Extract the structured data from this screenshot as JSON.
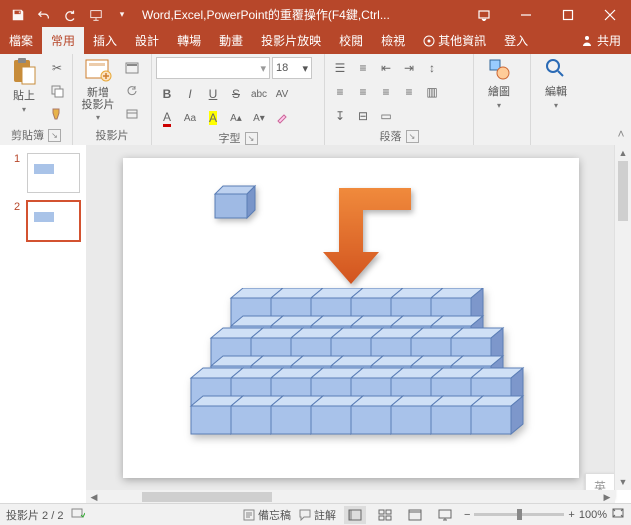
{
  "title": "Word,Excel,PowerPoint的重覆操作(F4鍵,Ctrl...",
  "tabs": {
    "file": "檔案",
    "home": "常用",
    "insert": "插入",
    "design": "設計",
    "transitions": "轉場",
    "animations": "動畫",
    "slideshow": "投影片放映",
    "review": "校閱",
    "view": "檢視",
    "tellme": "其他資訊",
    "signin": "登入",
    "share": "共用"
  },
  "ribbon": {
    "clipboard": {
      "label": "剪貼簿",
      "paste": "貼上"
    },
    "slides": {
      "label": "投影片",
      "new": "新增\n投影片"
    },
    "font": {
      "label": "字型",
      "size": "18"
    },
    "paragraph": {
      "label": "段落"
    },
    "drawing": {
      "label": "繪圖"
    },
    "editing": {
      "label": "編輯"
    }
  },
  "thumbs": [
    {
      "n": "1"
    },
    {
      "n": "2"
    }
  ],
  "ime": "英",
  "status": {
    "slide": "投影片 2 / 2",
    "lang": "",
    "notes": "備忘稿",
    "comments": "註解",
    "zoom": "100%"
  }
}
